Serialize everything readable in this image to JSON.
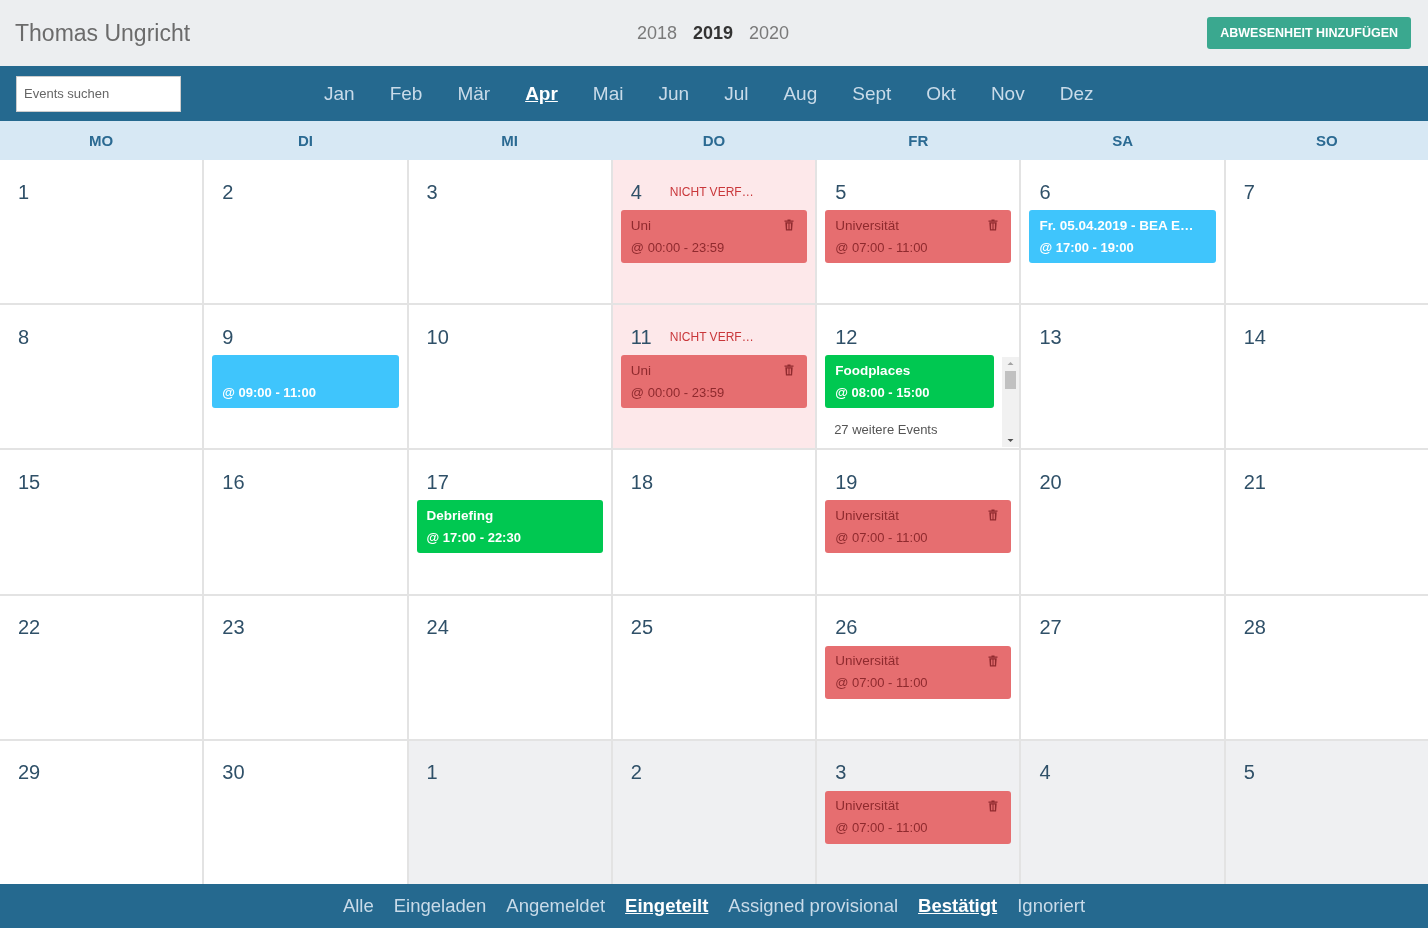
{
  "header": {
    "title": "Thomas Ungricht",
    "years": [
      {
        "label": "2018",
        "selected": false
      },
      {
        "label": "2019",
        "selected": true
      },
      {
        "label": "2020",
        "selected": false
      }
    ],
    "button": "ABWESENHEIT HINZUFÜGEN"
  },
  "nav": {
    "search": {
      "placeholder": "Events suchen"
    },
    "months": [
      {
        "label": "Jan",
        "selected": false
      },
      {
        "label": "Feb",
        "selected": false
      },
      {
        "label": "Mär",
        "selected": false
      },
      {
        "label": "Apr",
        "selected": true
      },
      {
        "label": "Mai",
        "selected": false
      },
      {
        "label": "Jun",
        "selected": false
      },
      {
        "label": "Jul",
        "selected": false
      },
      {
        "label": "Aug",
        "selected": false
      },
      {
        "label": "Sept",
        "selected": false
      },
      {
        "label": "Okt",
        "selected": false
      },
      {
        "label": "Nov",
        "selected": false
      },
      {
        "label": "Dez",
        "selected": false
      }
    ]
  },
  "weekdays": [
    "MO",
    "DI",
    "MI",
    "DO",
    "FR",
    "SA",
    "SO"
  ],
  "weeks": [
    {
      "days": [
        {
          "day": "1",
          "outside_month": false,
          "unavailable": false
        },
        {
          "day": "2",
          "outside_month": false,
          "unavailable": false
        },
        {
          "day": "3",
          "outside_month": false,
          "unavailable": false
        },
        {
          "day": "4",
          "outside_month": false,
          "unavailable": true,
          "note": "NICHT VERF…",
          "events": [
            {
              "kind": "absence",
              "color": "#e66e70",
              "title": "Uni",
              "time": "@ 00:00 - 23:59"
            }
          ]
        },
        {
          "day": "5",
          "outside_month": false,
          "unavailable": false,
          "events": [
            {
              "kind": "absence",
              "color": "#e66e70",
              "title": "Universität",
              "time": "@ 07:00 - 11:00"
            }
          ]
        },
        {
          "day": "6",
          "outside_month": false,
          "unavailable": false,
          "events": [
            {
              "kind": "event",
              "color": "#3fc5fc",
              "title": "Fr. 05.04.2019 - BEA E…",
              "time": "@ 17:00 - 19:00"
            }
          ]
        },
        {
          "day": "7",
          "outside_month": false,
          "unavailable": false
        }
      ]
    },
    {
      "days": [
        {
          "day": "8",
          "outside_month": false,
          "unavailable": false
        },
        {
          "day": "9",
          "outside_month": false,
          "unavailable": false,
          "events": [
            {
              "kind": "event",
              "color": "#3fc5fc",
              "time": "@ 09:00 - 11:00"
            }
          ]
        },
        {
          "day": "10",
          "outside_month": false,
          "unavailable": false
        },
        {
          "day": "11",
          "outside_month": false,
          "unavailable": true,
          "note": "NICHT VERF…",
          "events": [
            {
              "kind": "absence",
              "color": "#e66e70",
              "title": "Uni",
              "time": "@ 00:00 - 23:59"
            }
          ]
        },
        {
          "day": "12",
          "outside_month": false,
          "unavailable": false,
          "more_events": "27 weitere Events",
          "events": [
            {
              "kind": "event",
              "color": "#00c851",
              "title": "Foodplaces",
              "time": "@ 08:00 - 15:00"
            }
          ]
        },
        {
          "day": "13",
          "outside_month": false,
          "unavailable": false
        },
        {
          "day": "14",
          "outside_month": false,
          "unavailable": false
        }
      ]
    },
    {
      "days": [
        {
          "day": "15",
          "outside_month": false,
          "unavailable": false
        },
        {
          "day": "16",
          "outside_month": false,
          "unavailable": false
        },
        {
          "day": "17",
          "outside_month": false,
          "unavailable": false,
          "events": [
            {
              "kind": "event",
              "color": "#00c851",
              "title": "Debriefing",
              "time": "@ 17:00 - 22:30"
            }
          ]
        },
        {
          "day": "18",
          "outside_month": false,
          "unavailable": false
        },
        {
          "day": "19",
          "outside_month": false,
          "unavailable": false,
          "events": [
            {
              "kind": "absence",
              "color": "#e66e70",
              "title": "Universität",
              "time": "@ 07:00 - 11:00"
            }
          ]
        },
        {
          "day": "20",
          "outside_month": false,
          "unavailable": false
        },
        {
          "day": "21",
          "outside_month": false,
          "unavailable": false
        }
      ]
    },
    {
      "days": [
        {
          "day": "22",
          "outside_month": false,
          "unavailable": false
        },
        {
          "day": "23",
          "outside_month": false,
          "unavailable": false
        },
        {
          "day": "24",
          "outside_month": false,
          "unavailable": false
        },
        {
          "day": "25",
          "outside_month": false,
          "unavailable": false
        },
        {
          "day": "26",
          "outside_month": false,
          "unavailable": false,
          "events": [
            {
              "kind": "absence",
              "color": "#e66e70",
              "title": "Universität",
              "time": "@ 07:00 - 11:00"
            }
          ]
        },
        {
          "day": "27",
          "outside_month": false,
          "unavailable": false
        },
        {
          "day": "28",
          "outside_month": false,
          "unavailable": false
        }
      ]
    },
    {
      "days": [
        {
          "day": "29",
          "outside_month": false,
          "unavailable": false
        },
        {
          "day": "30",
          "outside_month": false,
          "unavailable": false
        },
        {
          "day": "1",
          "outside_month": true,
          "unavailable": false
        },
        {
          "day": "2",
          "outside_month": true,
          "unavailable": false
        },
        {
          "day": "3",
          "outside_month": true,
          "unavailable": false,
          "events": [
            {
              "kind": "absence",
              "color": "#e66e70",
              "title": "Universität",
              "time": "@ 07:00 - 11:00"
            }
          ]
        },
        {
          "day": "4",
          "outside_month": true,
          "unavailable": false
        },
        {
          "day": "5",
          "outside_month": true,
          "unavailable": false
        }
      ]
    }
  ],
  "filters": [
    {
      "label": "Alle",
      "selected": false
    },
    {
      "label": "Eingeladen",
      "selected": false
    },
    {
      "label": "Angemeldet",
      "selected": false
    },
    {
      "label": "Eingeteilt",
      "selected": true
    },
    {
      "label": "Assigned provisional",
      "selected": false
    },
    {
      "label": "Bestätigt",
      "selected": true
    },
    {
      "label": "Ignoriert",
      "selected": false
    }
  ]
}
